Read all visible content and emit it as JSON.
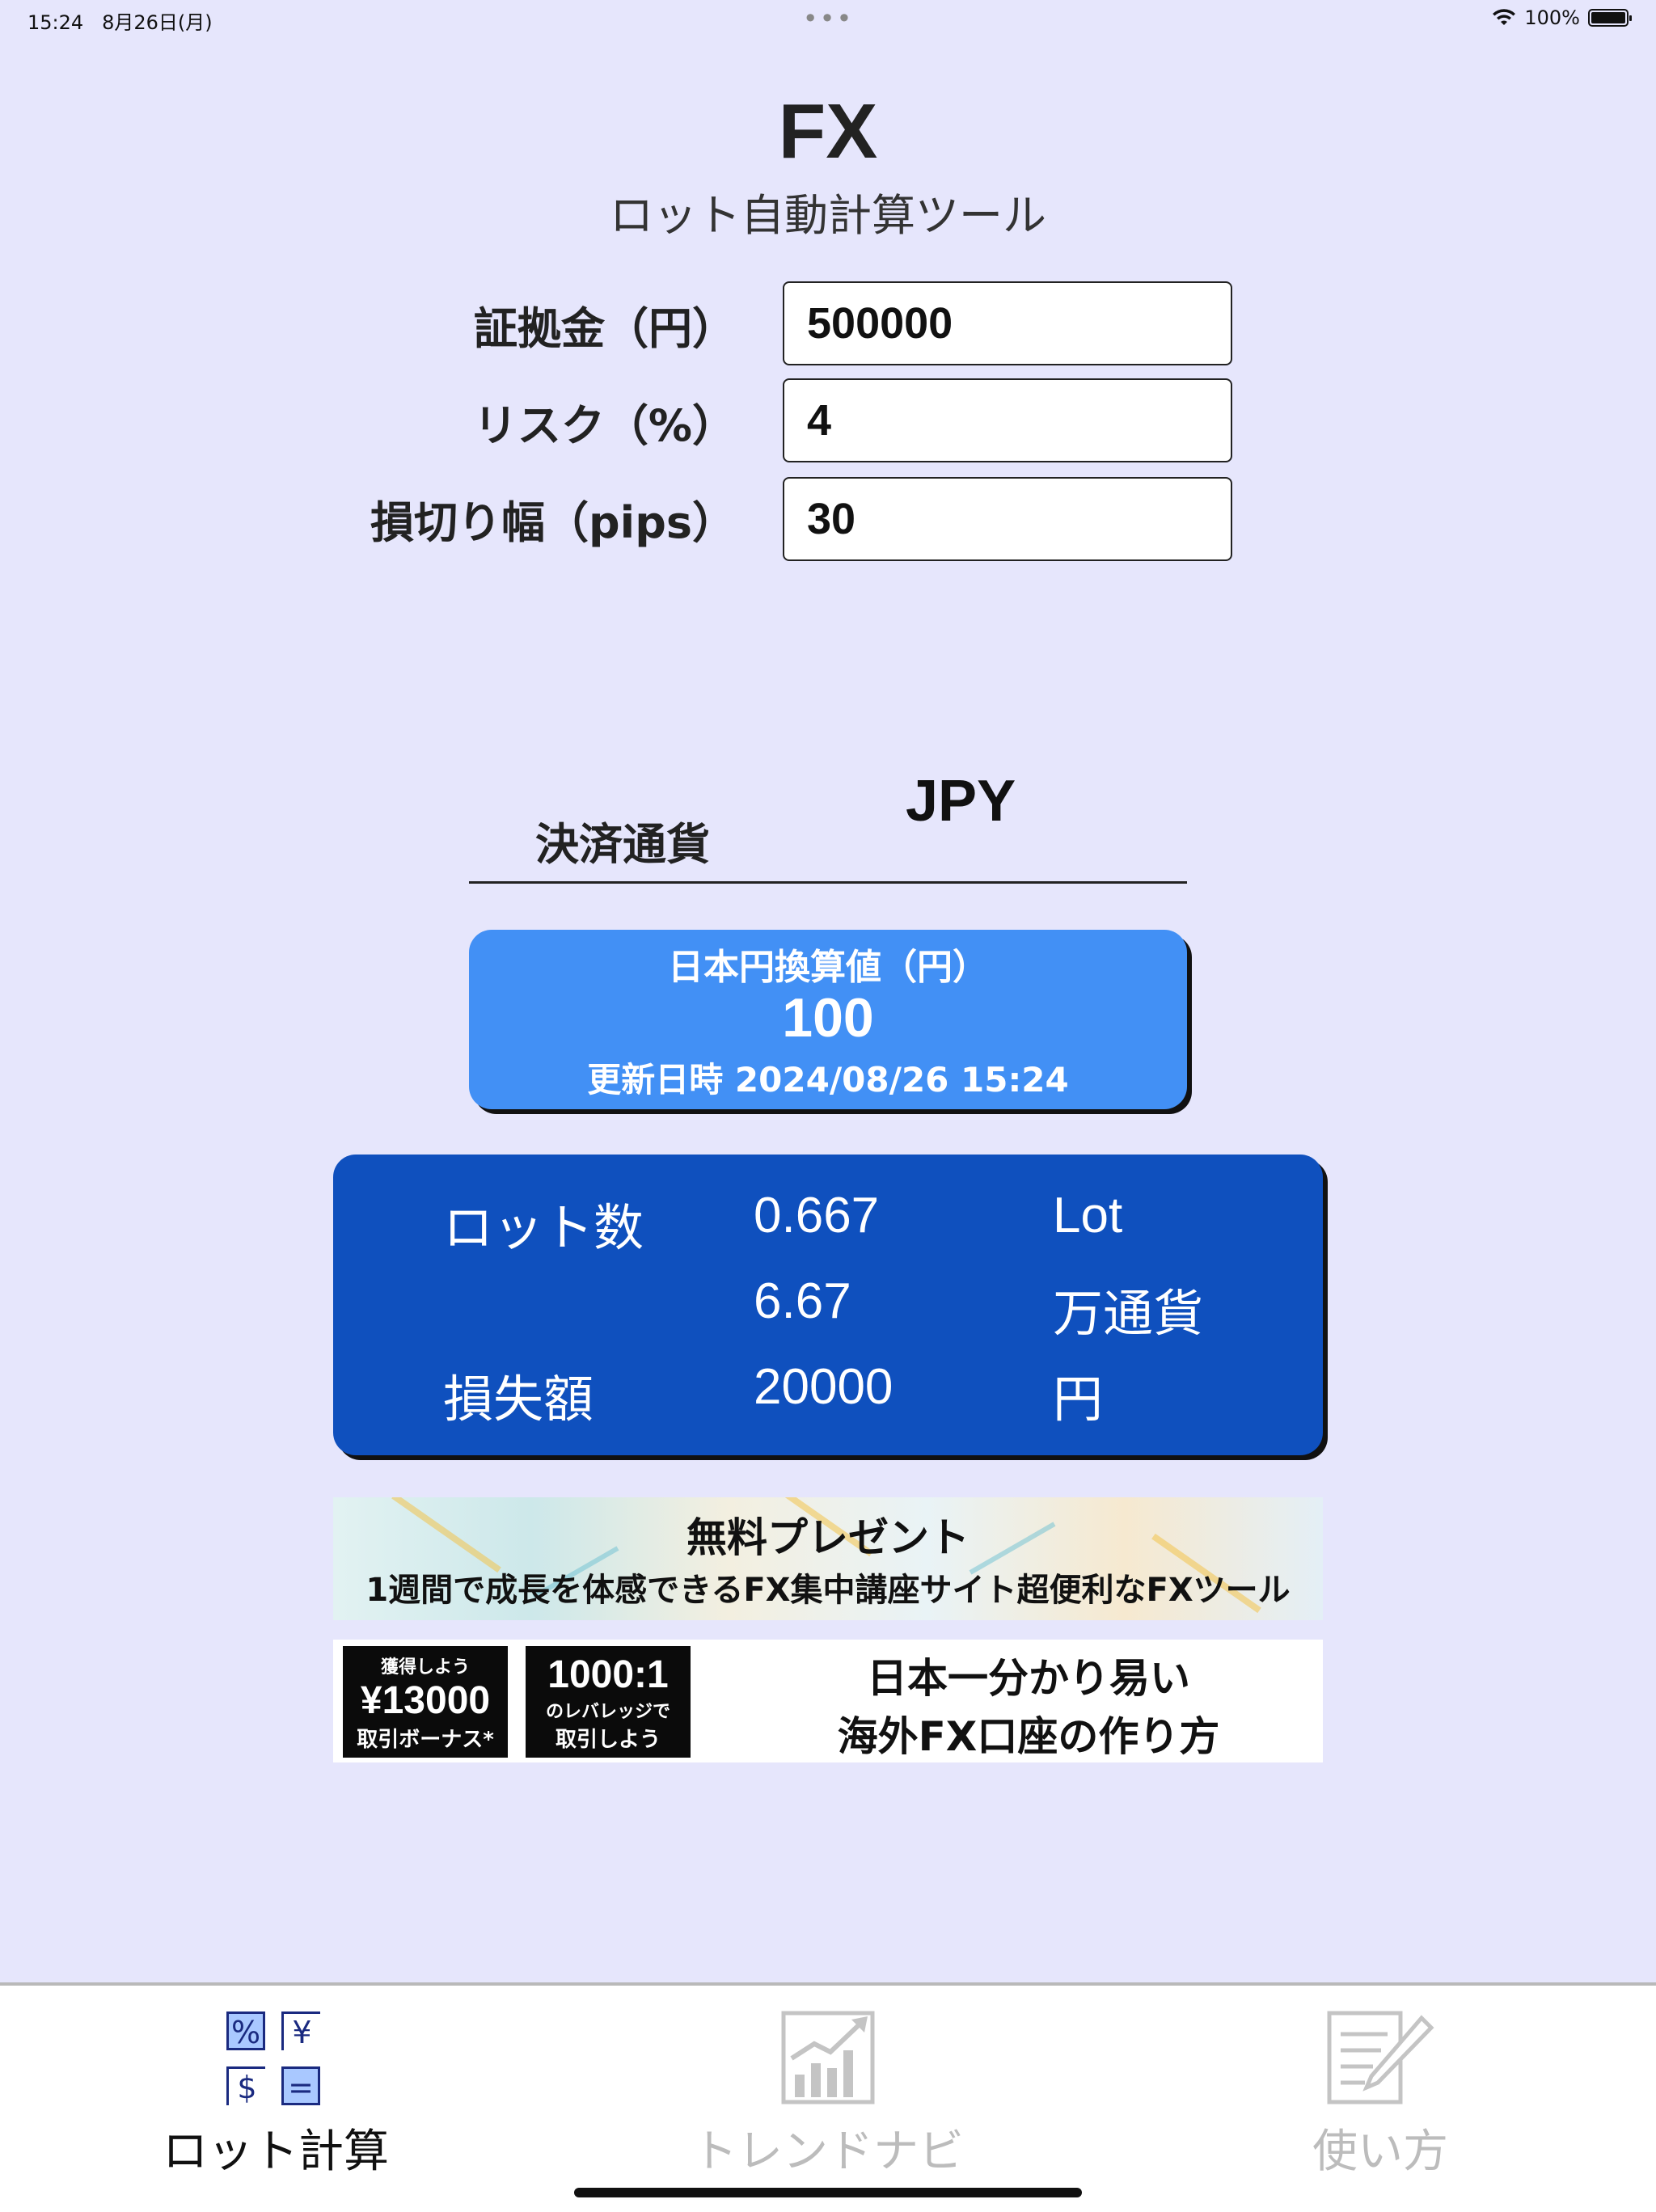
{
  "status_bar": {
    "time": "15:24",
    "date": "8月26日(月)",
    "center_dots": "•••",
    "battery_percent": "100%"
  },
  "header": {
    "title": "FX",
    "subtitle": "ロット自動計算ツール"
  },
  "form": {
    "margin_label": "証拠金（円）",
    "margin_value": "500000",
    "risk_label": "リスク（%）",
    "risk_value": "4",
    "stop_label": "損切り幅（pips）",
    "stop_value": "30"
  },
  "settlement": {
    "label": "決済通貨",
    "value": "JPY"
  },
  "conversion": {
    "title": "日本円換算値（円）",
    "value": "100",
    "updated": "更新日時 2024/08/26 15:24"
  },
  "result": {
    "lot_label": "ロット数",
    "lot_value": "0.667",
    "lot_unit": "Lot",
    "units_value": "6.67",
    "units_unit": "万通貨",
    "loss_label": "損失額",
    "loss_value": "20000",
    "loss_unit": "円"
  },
  "banner1": {
    "title": "無料プレゼント",
    "text": "1週間で成長を体感できるFX集中講座サイト超便利なFXツール"
  },
  "banner2": {
    "box1_small": "獲得しよう",
    "box1_big": "¥13000",
    "box1_sub": "取引ボーナス*",
    "box2_big": "1000:1",
    "box2_sub1": "のレバレッジで",
    "box2_sub2": "取引しよう",
    "line1": "日本一分かり易い",
    "line2": "海外FX口座の作り方"
  },
  "tabs": [
    {
      "label": "ロット計算",
      "icon": "calculator-icon",
      "active": true
    },
    {
      "label": "トレンドナビ",
      "icon": "chart-icon",
      "active": false
    },
    {
      "label": "使い方",
      "icon": "document-edit-icon",
      "active": false
    }
  ],
  "colors": {
    "background": "#e6e6fc",
    "conversion_card": "#4290f5",
    "result_card": "#0f50be",
    "tab_active": "#111111",
    "tab_inactive": "#bcbcbc"
  }
}
